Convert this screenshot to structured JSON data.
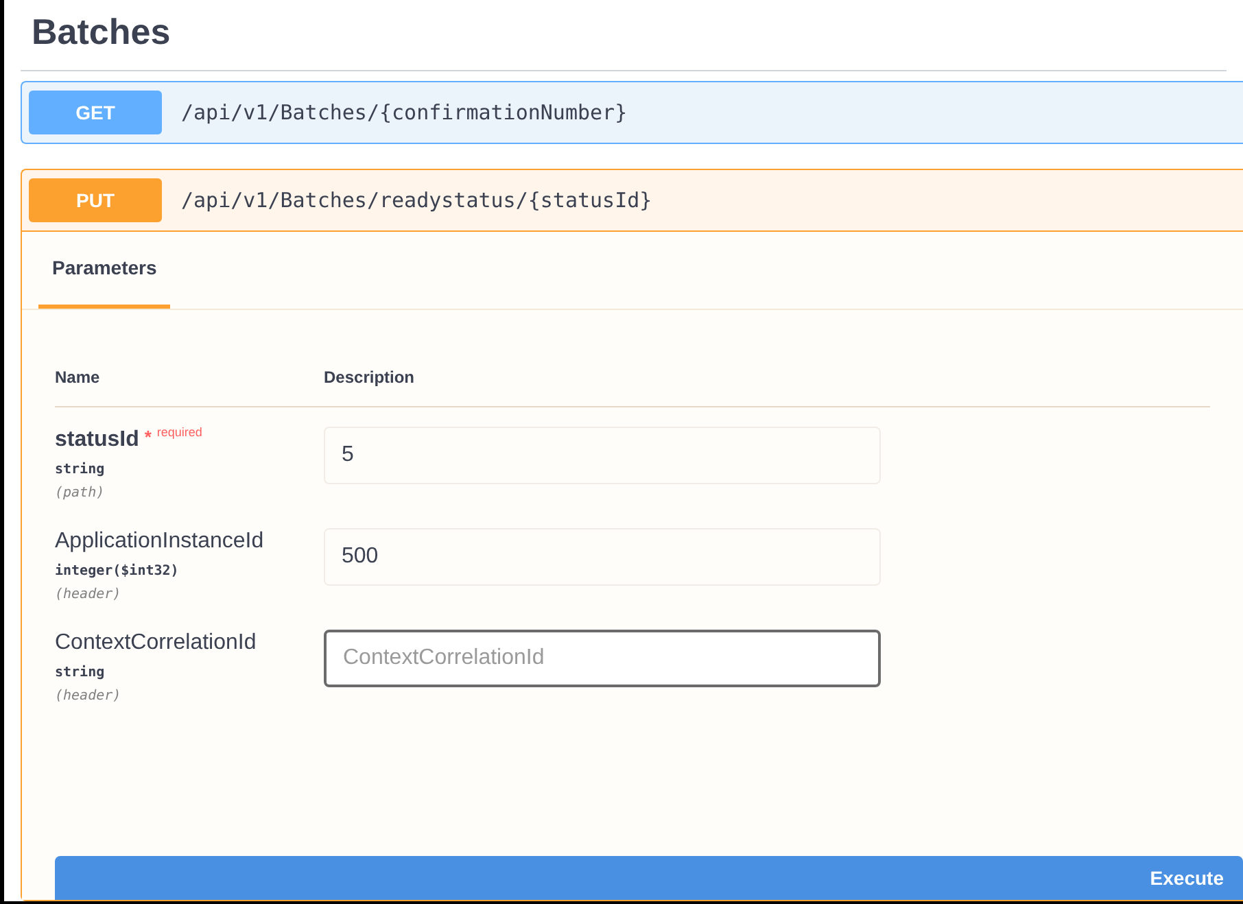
{
  "section_title": "Batches",
  "operations": [
    {
      "method": "GET",
      "path": "/api/v1/Batches/{confirmationNumber}",
      "expanded": false
    },
    {
      "method": "PUT",
      "path": "/api/v1/Batches/readystatus/{statusId}",
      "expanded": true
    }
  ],
  "tabs": [
    {
      "label": "Parameters",
      "selected": true
    }
  ],
  "columns": [
    "Name",
    "Description"
  ],
  "parameters": [
    {
      "name": "statusId",
      "required": true,
      "required_mark": "*",
      "required_label": "required",
      "type": "string",
      "location": "(path)",
      "value": "5",
      "focused": false
    },
    {
      "name": "ApplicationInstanceId",
      "required": false,
      "type": "integer($int32)",
      "location": "(header)",
      "value": "500",
      "focused": false
    },
    {
      "name": "ContextCorrelationId",
      "required": false,
      "type": "string",
      "location": "(header)",
      "placeholder": "ContextCorrelationId",
      "focused": true
    }
  ],
  "execute_button": "Execute"
}
